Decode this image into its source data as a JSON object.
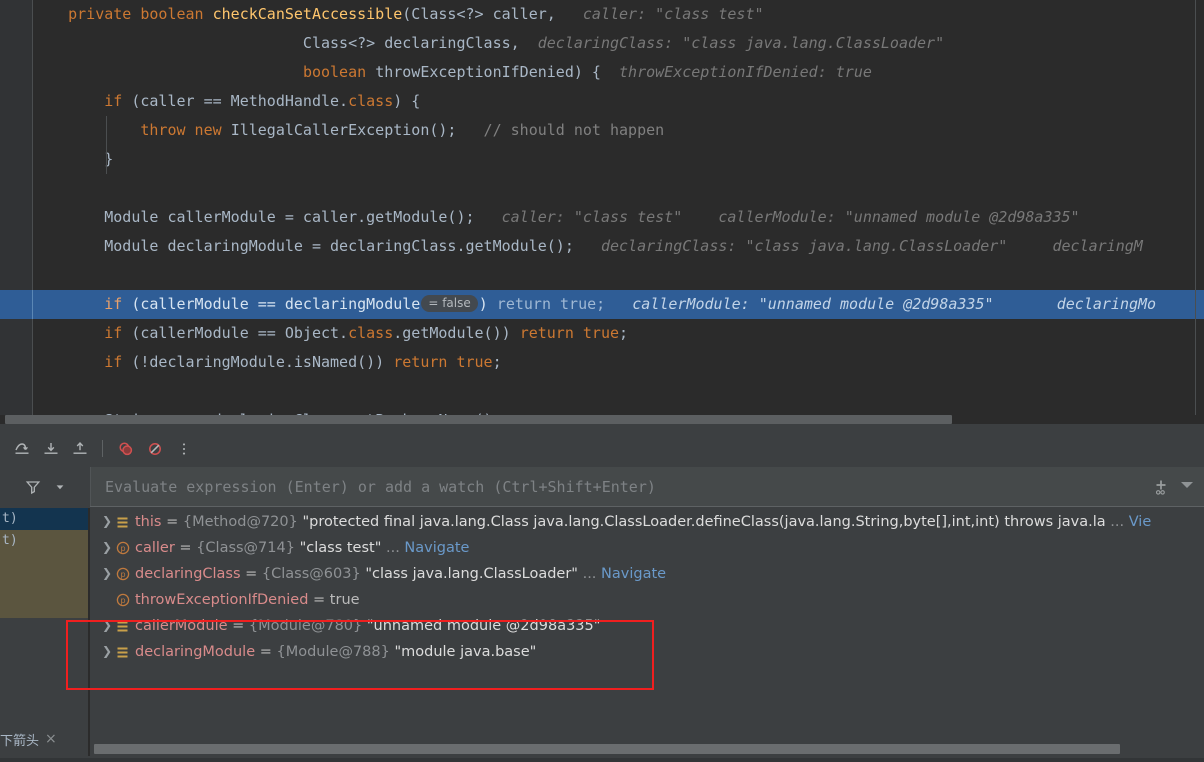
{
  "editor": {
    "lines": [
      {
        "indent": 0,
        "highlight": false,
        "tokens": [
          {
            "t": "kw",
            "v": "    private "
          },
          {
            "t": "kw",
            "v": "boolean "
          },
          {
            "t": "mth",
            "v": "checkCanSetAccessible"
          },
          {
            "t": "pl",
            "v": "(Class<?> caller,"
          },
          {
            "t": "hint",
            "v": "   caller: \"class test\""
          }
        ]
      },
      {
        "indent": 0,
        "highlight": false,
        "tokens": [
          {
            "t": "pl",
            "v": "                              Class<?> declaringClass,"
          },
          {
            "t": "hint",
            "v": "  declaringClass: \"class java.lang.ClassLoader\""
          }
        ]
      },
      {
        "indent": 0,
        "highlight": false,
        "tokens": [
          {
            "t": "pl",
            "v": "                              "
          },
          {
            "t": "kw",
            "v": "boolean "
          },
          {
            "t": "pl",
            "v": "throwExceptionIfDenied) {"
          },
          {
            "t": "hint",
            "v": "  throwExceptionIfDenied: true"
          }
        ]
      },
      {
        "indent": 0,
        "highlight": false,
        "tokens": [
          {
            "t": "pl",
            "v": "        "
          },
          {
            "t": "kw",
            "v": "if "
          },
          {
            "t": "pl",
            "v": "(caller == MethodHandle."
          },
          {
            "t": "kw",
            "v": "class"
          },
          {
            "t": "pl",
            "v": ") {"
          }
        ]
      },
      {
        "indent": 1,
        "highlight": false,
        "tokens": [
          {
            "t": "pl",
            "v": "            "
          },
          {
            "t": "kw",
            "v": "throw new "
          },
          {
            "t": "pl",
            "v": "IllegalCallerException();"
          },
          {
            "t": "cmt",
            "v": "   // should not happen"
          }
        ]
      },
      {
        "indent": 1,
        "highlight": false,
        "tokens": [
          {
            "t": "pl",
            "v": "        }"
          }
        ]
      },
      {
        "indent": 0,
        "highlight": false,
        "tokens": [
          {
            "t": "pl",
            "v": ""
          }
        ]
      },
      {
        "indent": 0,
        "highlight": false,
        "tokens": [
          {
            "t": "pl",
            "v": "        Module callerModule = caller.getModule();"
          },
          {
            "t": "hint",
            "v": "   caller: \"class test\"    callerModule: \"unnamed module @2d98a335\""
          }
        ]
      },
      {
        "indent": 0,
        "highlight": false,
        "tokens": [
          {
            "t": "pl",
            "v": "        Module declaringModule = declaringClass.getModule();"
          },
          {
            "t": "hint",
            "v": "   declaringClass: \"class java.lang.ClassLoader\"     declaringM"
          }
        ]
      },
      {
        "indent": 0,
        "highlight": false,
        "tokens": [
          {
            "t": "pl",
            "v": ""
          }
        ]
      },
      {
        "indent": 0,
        "highlight": true,
        "tokens": [
          {
            "t": "pl-hl",
            "v": "        "
          },
          {
            "t": "kw-hl",
            "v": "if "
          },
          {
            "t": "pl-hl",
            "v": "(callerModule == declaringModule"
          },
          {
            "t": "inlay",
            "v": "= false"
          },
          {
            "t": "pl-hl",
            "v": ")"
          },
          {
            "t": "dim-hl",
            "v": " return true;"
          },
          {
            "t": "hint-hl",
            "v": "   callerModule: \"unnamed module @2d98a335\"       declaringMo"
          }
        ]
      },
      {
        "indent": 0,
        "highlight": false,
        "tokens": [
          {
            "t": "pl",
            "v": "        "
          },
          {
            "t": "kw",
            "v": "if "
          },
          {
            "t": "pl",
            "v": "(callerModule == Object."
          },
          {
            "t": "kw",
            "v": "class"
          },
          {
            "t": "pl",
            "v": ".getModule()) "
          },
          {
            "t": "kw",
            "v": "return true"
          },
          {
            "t": "pl",
            "v": ";"
          }
        ]
      },
      {
        "indent": 0,
        "highlight": false,
        "tokens": [
          {
            "t": "pl",
            "v": "        "
          },
          {
            "t": "kw",
            "v": "if "
          },
          {
            "t": "pl",
            "v": "(!declaringModule.isNamed()) "
          },
          {
            "t": "kw",
            "v": "return true"
          },
          {
            "t": "pl",
            "v": ";"
          }
        ]
      },
      {
        "indent": 0,
        "highlight": false,
        "tokens": [
          {
            "t": "pl",
            "v": ""
          }
        ]
      },
      {
        "indent": 0,
        "highlight": false,
        "tokens": [
          {
            "t": "pl",
            "v": "        String pn = declaringClass.getPackageName();"
          }
        ]
      }
    ]
  },
  "debugger": {
    "toolbar": [
      {
        "name": "step-over-button",
        "label": "Step Over"
      },
      {
        "name": "step-into-button",
        "label": "Step Into"
      },
      {
        "name": "step-out-button",
        "label": "Step Out"
      },
      {
        "name": "view-breakpoints-button",
        "label": "View Breakpoints"
      },
      {
        "name": "mute-breakpoints-button",
        "label": "Mute Breakpoints"
      },
      {
        "name": "more-options-button",
        "label": "More"
      }
    ],
    "filter": {
      "label": "Filter",
      "dropdown": "▾"
    },
    "evaluate": {
      "placeholder": "Evaluate expression (Enter) or add a watch (Ctrl+Shift+Enter)",
      "value": "",
      "add_watch_label": "+"
    },
    "frames": [
      {
        "text": "t)",
        "state": "selected"
      },
      {
        "text": "t)",
        "state": "marked"
      }
    ],
    "variables": [
      {
        "name": "this",
        "icon": "field-icon",
        "expandable": true,
        "ref": "{Method@720}",
        "value": "\"protected final java.lang.Class java.lang.ClassLoader.defineClass(java.lang.String,byte[],int,int) throws java.la",
        "ellipsis": "...",
        "link": "Vie",
        "highlighted": false
      },
      {
        "name": "caller",
        "icon": "parameter-icon",
        "expandable": true,
        "ref": "{Class@714}",
        "value": "\"class test\"",
        "ellipsis": "...",
        "link": "Navigate",
        "highlighted": false
      },
      {
        "name": "declaringClass",
        "icon": "parameter-icon",
        "expandable": true,
        "ref": "{Class@603}",
        "value": "\"class java.lang.ClassLoader\"",
        "ellipsis": "...",
        "link": "Navigate",
        "highlighted": false
      },
      {
        "name": "throwExceptionIfDenied",
        "icon": "parameter-icon",
        "expandable": false,
        "ref": "",
        "value": "true",
        "ellipsis": "",
        "link": "",
        "highlighted": false
      },
      {
        "name": "callerModule",
        "icon": "field-icon",
        "expandable": true,
        "ref": "{Module@780}",
        "value": "\"unnamed module @2d98a335\"",
        "ellipsis": "",
        "link": "",
        "highlighted": true
      },
      {
        "name": "declaringModule",
        "icon": "field-icon",
        "expandable": true,
        "ref": "{Module@788}",
        "value": "\"module java.base\"",
        "ellipsis": "",
        "link": "",
        "highlighted": true
      }
    ],
    "bottom_tab": {
      "label": "下箭头",
      "close": "×"
    }
  },
  "colors": {
    "editor_bg": "#2b2b2b",
    "panel_bg": "#3c3f41",
    "selection_blue": "#2f5d96",
    "keyword_orange": "#cc7832",
    "method_yellow": "#ffc66d",
    "plain_text": "#a9b7c6",
    "hint_gray": "#787878",
    "highlight_red_border": "#f01f1f",
    "link_blue": "#6a99c9",
    "var_name_red": "#d98b8b"
  }
}
